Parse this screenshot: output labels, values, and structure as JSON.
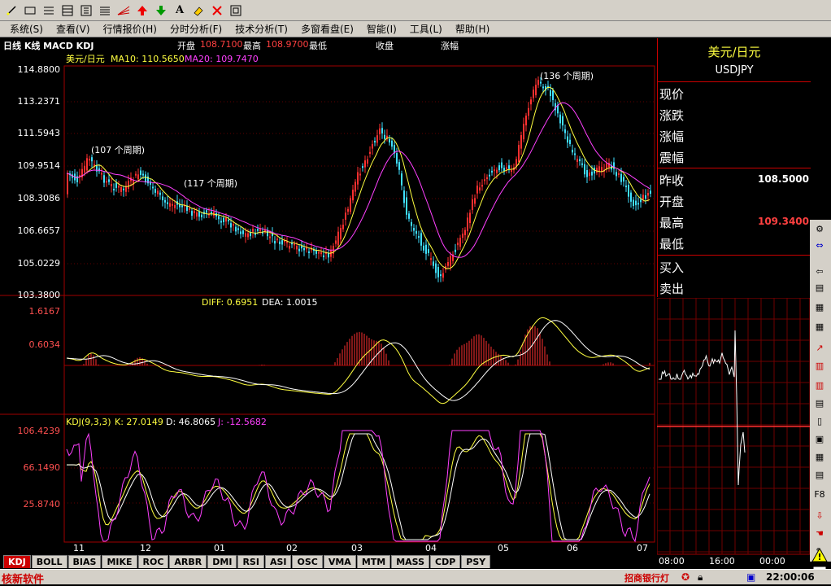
{
  "toolbar": {
    "icons": [
      "pen-icon",
      "rect-icon",
      "menu-icon",
      "table-icon",
      "bars-icon",
      "list-icon",
      "fan-icon",
      "up-arrow-icon",
      "down-arrow-icon",
      "text-icon",
      "eraser-icon",
      "delete-icon",
      "frame-icon"
    ]
  },
  "menu": {
    "items": [
      "系统(S)",
      "查看(V)",
      "行情报价(H)",
      "分时分析(F)",
      "技术分析(T)",
      "多窗看盘(E)",
      "智能(I)",
      "工具(L)",
      "帮助(H)"
    ]
  },
  "header": {
    "period": "日线 K线 MACD KDJ",
    "open_label": "开盘",
    "open_value": "108.7100",
    "high_label": "最高",
    "high_value": "108.9700",
    "low_label": "最低",
    "close_label": "收盘",
    "change_label": "涨幅"
  },
  "price_panel": {
    "legend_symbol": "美元/日元",
    "ma10": "MA10: 110.5650",
    "ma20": "MA20: 109.7470",
    "y_ticks": [
      "114.8800",
      "113.2371",
      "111.5943",
      "109.9514",
      "108.3086",
      "106.6657",
      "105.0229",
      "103.3800"
    ],
    "annotations": [
      "(107 个周期)",
      "(117 个周期)",
      "(136 个周期)"
    ]
  },
  "macd_panel": {
    "diff": "DIFF: 0.6951",
    "dea": "DEA: 1.0015",
    "y_ticks": [
      "1.6167",
      "0.6034"
    ]
  },
  "kdj_panel": {
    "title": "KDJ(9,3,3)",
    "k": "K: 27.0149",
    "d": "D: 46.8065",
    "j": "J: -12.5682",
    "y_ticks": [
      "106.4239",
      "66.1490",
      "25.8740"
    ]
  },
  "x_axis": {
    "months": [
      "11",
      "12",
      "01",
      "02",
      "03",
      "04",
      "05",
      "06",
      "07"
    ]
  },
  "quote": {
    "name": "美元/日元",
    "code": "USDJPY",
    "rows": [
      {
        "label": "现价",
        "value": ""
      },
      {
        "label": "涨跌",
        "value": ""
      },
      {
        "label": "涨幅",
        "value": ""
      },
      {
        "label": "震幅",
        "value": ""
      },
      {
        "label": "昨收",
        "value": "108.5000"
      },
      {
        "label": "开盘",
        "value": ""
      },
      {
        "label": "最高",
        "value": "109.3400"
      },
      {
        "label": "最低",
        "value": ""
      },
      {
        "label": "买入",
        "value": ""
      },
      {
        "label": "卖出",
        "value": ""
      }
    ]
  },
  "intraday": {
    "times": [
      "08:00",
      "16:00",
      "00:00"
    ]
  },
  "tabs": [
    "KDJ",
    "BOLL",
    "BIAS",
    "MIKE",
    "ROC",
    "ARBR",
    "DMI",
    "RSI",
    "ASI",
    "OSC",
    "VMA",
    "MTM",
    "MASS",
    "CDP",
    "PSY"
  ],
  "status": {
    "brand": "核新软件",
    "bank": "招商银行灯",
    "clock": "22:00:06"
  },
  "colors": {
    "ma10": "#ffff40",
    "ma20": "#ff40ff",
    "up_candle": "#ff3030",
    "down_candle": "#40e0ff",
    "grid_red": "#a00000",
    "axis_red": "#ff5050"
  }
}
